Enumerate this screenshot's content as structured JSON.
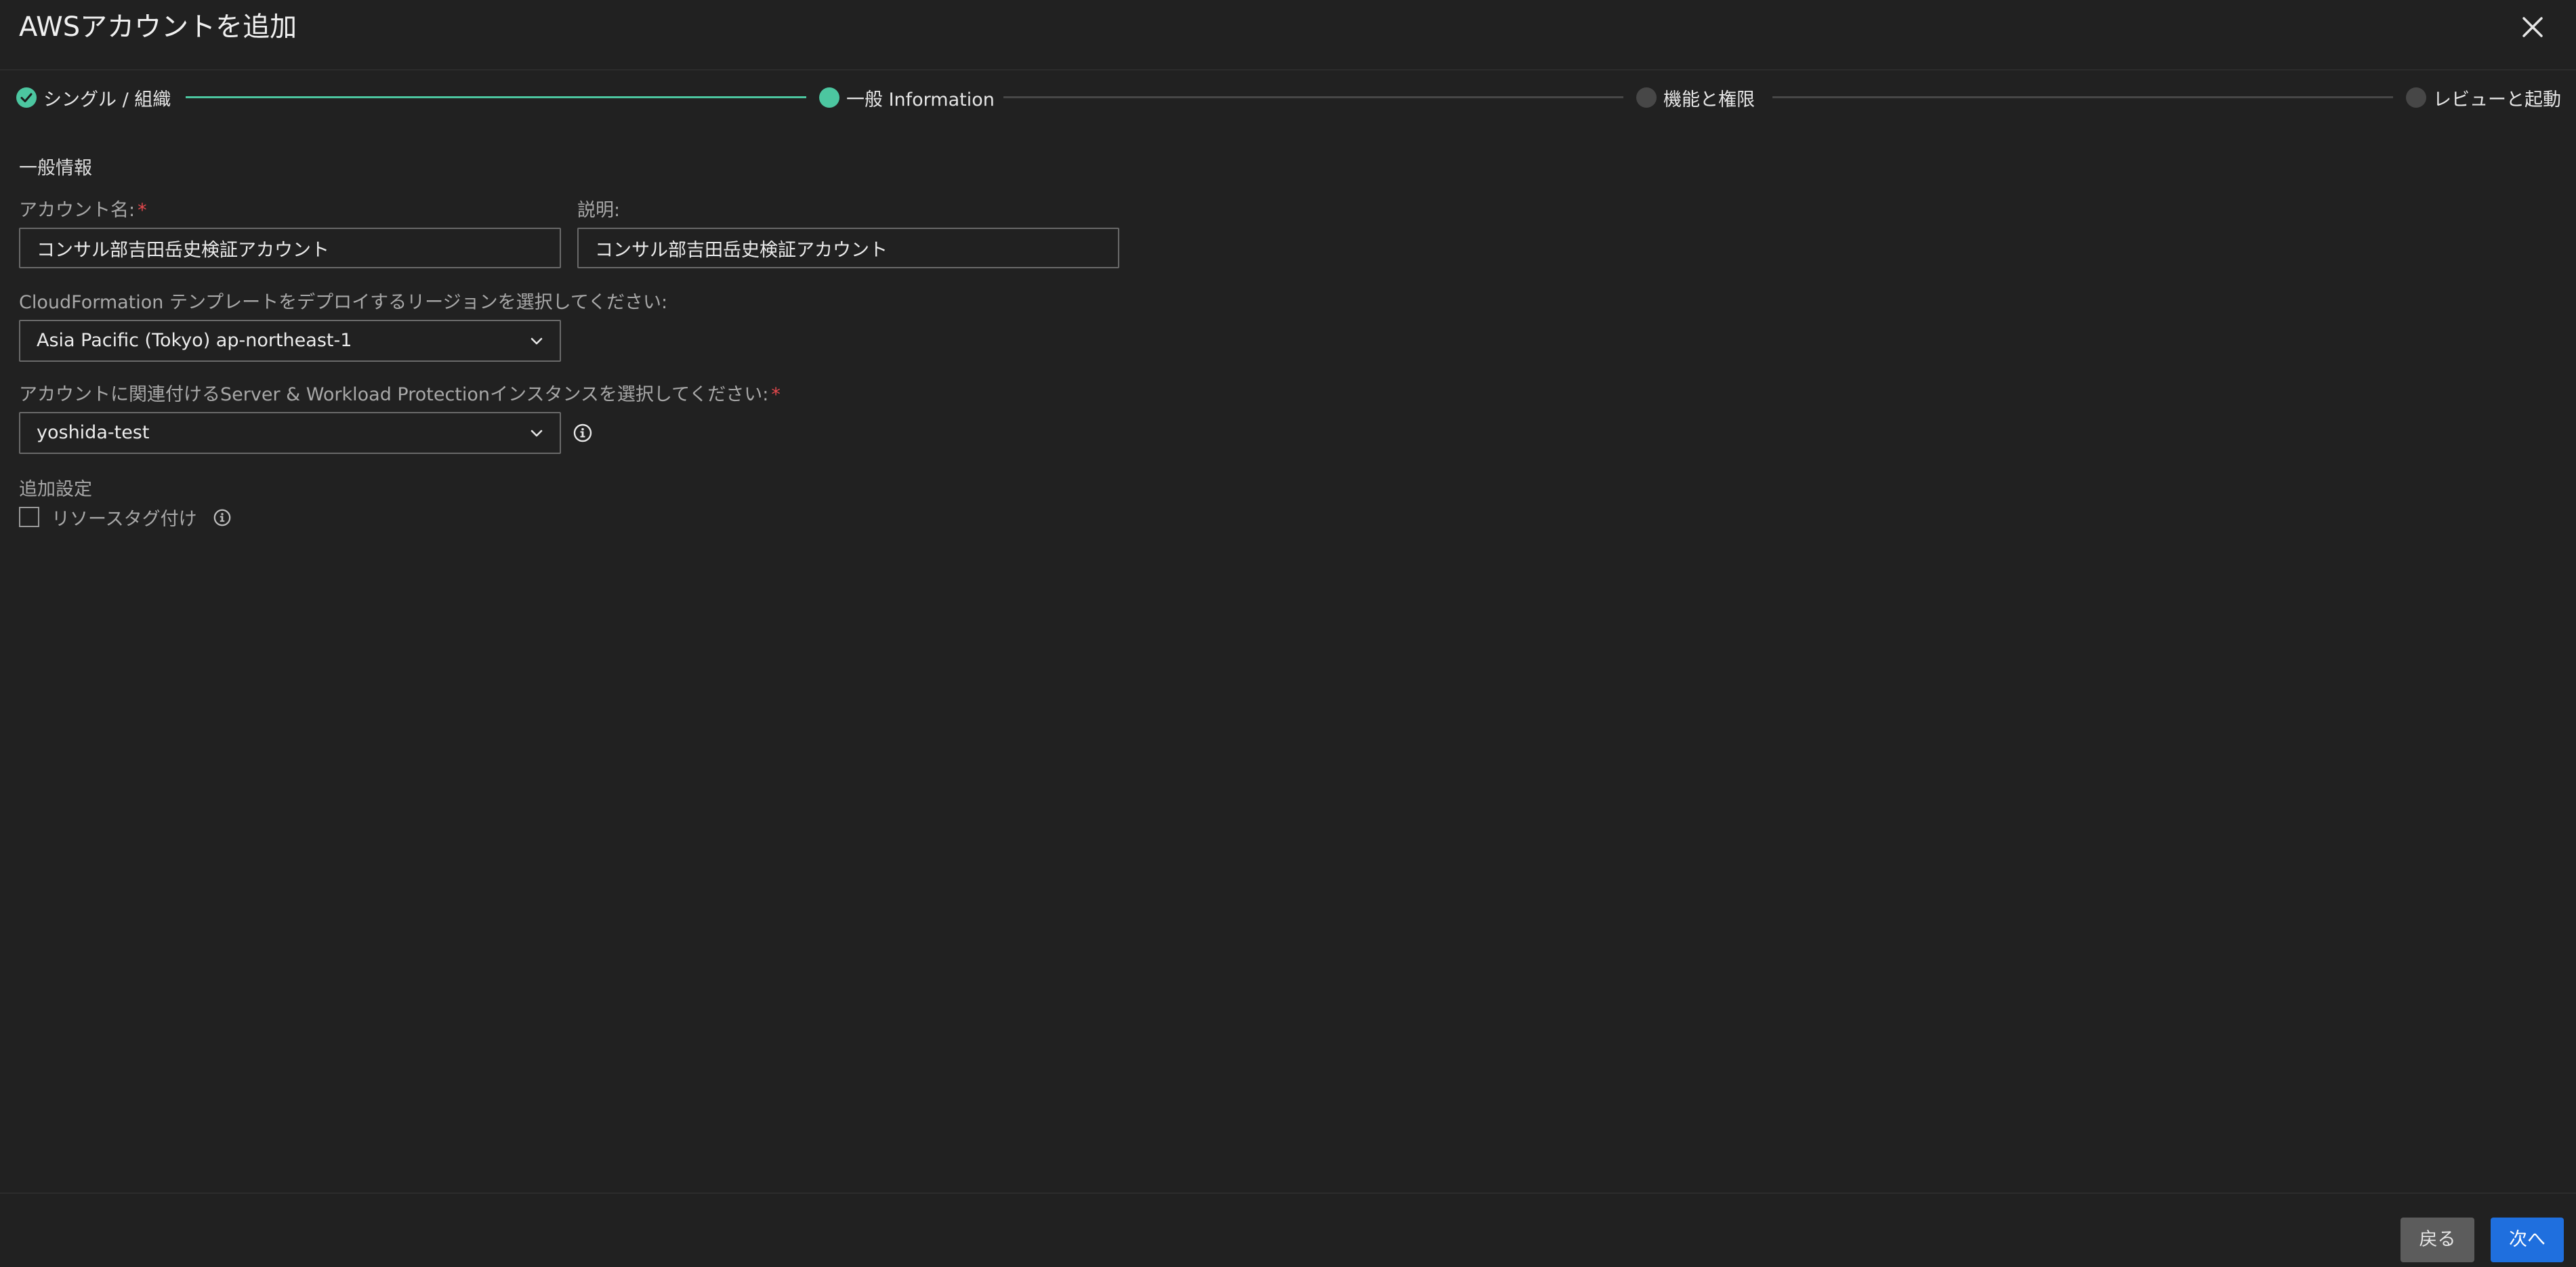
{
  "dialog": {
    "title": "AWSアカウントを追加"
  },
  "stepper": {
    "steps": [
      {
        "label": "シングル / 組織",
        "state": "completed"
      },
      {
        "label": "一般 Information",
        "state": "active"
      },
      {
        "label": "機能と権限",
        "state": "pending"
      },
      {
        "label": "レビューと起動",
        "state": "pending"
      }
    ]
  },
  "form": {
    "section_title": "一般情報",
    "account_name": {
      "label": "アカウント名:",
      "required_mark": "*",
      "value": "コンサル部吉田岳史検証アカウント"
    },
    "description": {
      "label": "説明:",
      "value": "コンサル部吉田岳史検証アカウント"
    },
    "region": {
      "label": "CloudFormation テンプレートをデプロイするリージョンを選択してください:",
      "selected": "Asia Pacific (Tokyo) ap-northeast-1"
    },
    "instance": {
      "label": "アカウントに関連付けるServer & Workload Protectionインスタンスを選択してください:",
      "required_mark": "*",
      "selected": "yoshida-test"
    },
    "additional_settings": {
      "title": "追加設定",
      "resource_tagging_label": "リソースタグ付け",
      "resource_tagging_checked": false
    }
  },
  "footer": {
    "back_label": "戻る",
    "next_label": "次へ"
  },
  "colors": {
    "background": "#212121",
    "accent_green": "#4cc6a0",
    "primary_blue": "#1f6fde",
    "required_red": "#e5484d"
  }
}
